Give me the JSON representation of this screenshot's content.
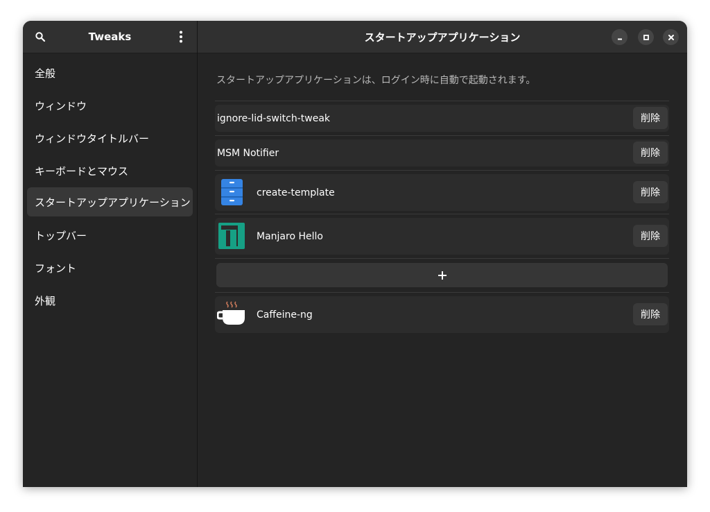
{
  "header": {
    "app_title": "Tweaks",
    "page_title": "スタートアップアプリケーション",
    "search_icon": "search-icon",
    "menu_icon": "kebab-menu-icon"
  },
  "window_controls": [
    "minimize-icon",
    "maximize-icon",
    "close-icon"
  ],
  "sidebar": {
    "selected_index": 4,
    "items": [
      {
        "label": "全般"
      },
      {
        "label": "ウィンドウ"
      },
      {
        "label": "ウィンドウタイトルバー"
      },
      {
        "label": "キーボードとマウス"
      },
      {
        "label": "スタートアップアプリケーション"
      },
      {
        "label": "トップバー"
      },
      {
        "label": "フォント"
      },
      {
        "label": "外観"
      }
    ]
  },
  "main": {
    "description": "スタートアップアプリケーションは、ログイン時に自動で起動されます。",
    "remove_label": "削除",
    "add_icon": "plus-icon",
    "apps": [
      {
        "name": "ignore-lid-switch-tweak",
        "icon": "none"
      },
      {
        "name": "MSM Notifier",
        "icon": "none"
      },
      {
        "name": "create-template",
        "icon": "file-cabinet-icon"
      },
      {
        "name": "Manjaro Hello",
        "icon": "manjaro-logo-icon"
      },
      {
        "name": "Caffeine-ng",
        "icon": "coffee-cup-icon"
      }
    ]
  },
  "colors": {
    "window_bg": "#242424",
    "headerbar_bg": "#303030",
    "row_bg": "#2c2c2c",
    "button_bg": "#3a3a3a",
    "manjaro_green": "#35bf5c",
    "template_blue": "#3584e4"
  }
}
